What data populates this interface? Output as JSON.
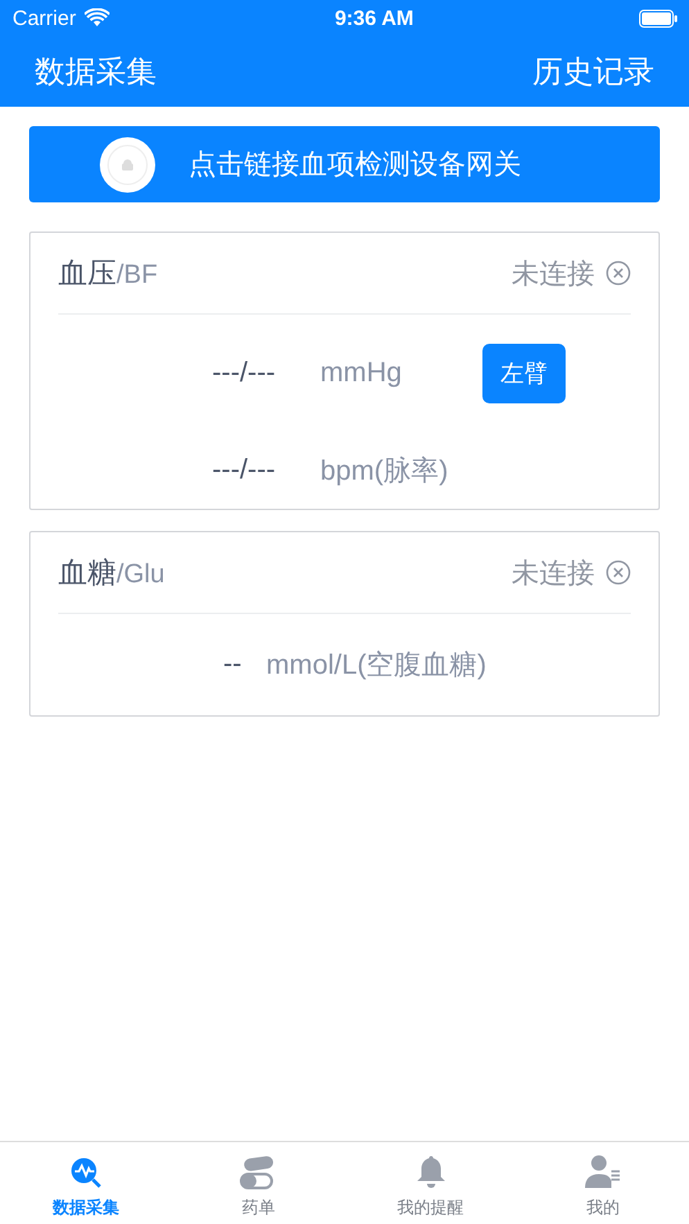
{
  "status_bar": {
    "carrier": "Carrier",
    "time": "9:36 AM"
  },
  "nav": {
    "title": "数据采集",
    "action": "历史记录"
  },
  "connect_banner": {
    "label": "点击链接血项检测设备网关"
  },
  "cards": [
    {
      "name": "血压",
      "code": "/BF",
      "status": "未连接",
      "connected": false,
      "readings": [
        {
          "value": "---/---",
          "unit": "mmHg",
          "arm_button": "左臂"
        },
        {
          "value": "---/---",
          "unit": "bpm(脉率)"
        }
      ]
    },
    {
      "name": "血糖",
      "code": "/Glu",
      "status": "未连接",
      "connected": false,
      "readings": [
        {
          "value": "--",
          "unit": "mmol/L(空腹血糖)"
        }
      ]
    }
  ],
  "tabs": [
    {
      "label": "数据采集",
      "kind": "collect",
      "selected": true
    },
    {
      "label": "药单",
      "kind": "pills",
      "selected": false
    },
    {
      "label": "我的提醒",
      "kind": "bell",
      "selected": false
    },
    {
      "label": "我的",
      "kind": "user",
      "selected": false
    }
  ]
}
